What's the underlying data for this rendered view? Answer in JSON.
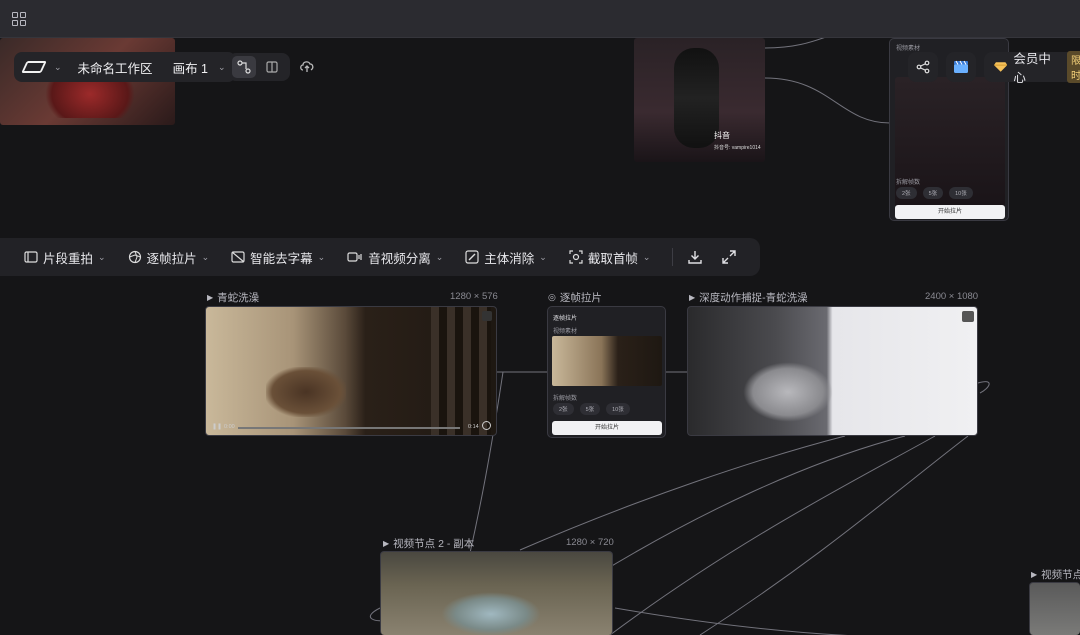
{
  "header": {
    "workspace_name": "未命名工作区",
    "canvas_name": "画布 1"
  },
  "right_actions": {
    "member_label": "会员中心",
    "member_tag": "限时"
  },
  "toolbar": {
    "items": [
      {
        "label": "片段重拍",
        "icon": "clip-retake-icon"
      },
      {
        "label": "逐帧拉片",
        "icon": "frame-by-frame-icon"
      },
      {
        "label": "智能去字幕",
        "icon": "remove-subtitle-icon"
      },
      {
        "label": "音视频分离",
        "icon": "av-separate-icon"
      },
      {
        "label": "主体消除",
        "icon": "erase-subject-icon"
      },
      {
        "label": "截取首帧",
        "icon": "capture-first-frame-icon"
      }
    ]
  },
  "nodes": {
    "video1": {
      "title": "青蛇洗澡",
      "dims": "1280 × 576",
      "time_start": "0:00",
      "time_end": "0:14"
    },
    "frame": {
      "title": "逐帧拉片",
      "panel_title": "逐帧拉片",
      "panel_sub": "视频素材",
      "panel_sub2": "拆解帧数",
      "chip1": "2张",
      "chip2": "5张",
      "chip3": "10张",
      "button": "开始拉片"
    },
    "depth": {
      "title": "深度动作捕捉-青蛇洗澡",
      "dims": "2400 × 1080"
    },
    "copy": {
      "title": "视频节点 2 - 副本",
      "dims": "1280 × 720"
    },
    "partial": {
      "title": "视频节点"
    },
    "top_right_panel": {
      "sub": "视频素材",
      "sub2": "拆解帧数",
      "chip1": "2张",
      "chip2": "5张",
      "chip3": "10张",
      "button": "开始拉片"
    },
    "douyin": {
      "brand": "抖音",
      "account": "抖音号: vampire1014"
    }
  },
  "colors": {
    "background": "#151517",
    "accent_gold": "#f5d27a",
    "edge": "#8a8a92"
  }
}
